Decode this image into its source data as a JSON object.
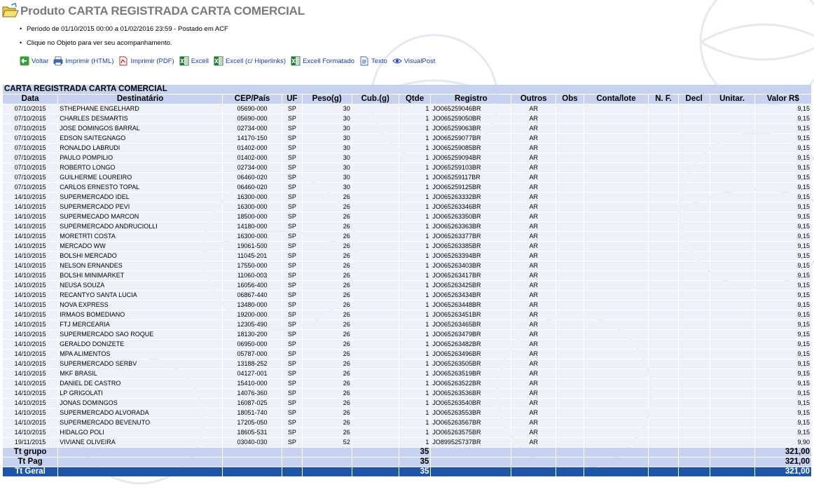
{
  "page": {
    "title": "Produto CARTA REGISTRADA CARTA COMERCIAL",
    "bullets": [
      "Período de 01/10/2015 00:00 a 01/02/2016 23:59 - Postado em ACF",
      "Clique no Objeto para ver seu acompanhamento."
    ]
  },
  "toolbar": [
    {
      "label": "Voltar",
      "icon": "back-arrow-icon"
    },
    {
      "label": "Imprimir (HTML)",
      "icon": "printer-icon"
    },
    {
      "label": "Imprimir (PDF)",
      "icon": "pdf-icon"
    },
    {
      "label": "Excell",
      "icon": "excel-icon"
    },
    {
      "label": "Excell (c/ Hiperlinks)",
      "icon": "excel-icon"
    },
    {
      "label": "Excell Formatado",
      "icon": "excel-icon"
    },
    {
      "label": "Texto",
      "icon": "text-file-icon"
    },
    {
      "label": "VisualPost",
      "icon": "eye-icon"
    }
  ],
  "table": {
    "caption": "CARTA REGISTRADA CARTA COMERCIAL",
    "columns": [
      "Data",
      "Destinatário",
      "CEP/País",
      "UF",
      "Peso(g)",
      "Cub.(g)",
      "Qtde",
      "Registro",
      "Outros",
      "Obs",
      "Conta/lote",
      "N. F.",
      "Decl",
      "Unitar.",
      "Valor R$"
    ],
    "rows": [
      [
        "07/10/2015",
        "STHEPHANE ENGELHARD",
        "05690-000",
        "SP",
        "30",
        "",
        "1",
        "JO065259046BR",
        "AR",
        "",
        "",
        "",
        "",
        "",
        "9,15"
      ],
      [
        "07/10/2015",
        "CHARLES DESMARTIS",
        "05690-000",
        "SP",
        "30",
        "",
        "1",
        "JO065259050BR",
        "AR",
        "",
        "",
        "",
        "",
        "",
        "9,15"
      ],
      [
        "07/10/2015",
        "JOSE DOMINGOS BARRAL",
        "02734-000",
        "SP",
        "30",
        "",
        "1",
        "JO065259063BR",
        "AR",
        "",
        "",
        "",
        "",
        "",
        "9,15"
      ],
      [
        "07/10/2015",
        "EDSON SAITEGNAGO",
        "14170-150",
        "SP",
        "30",
        "",
        "1",
        "JO065259077BR",
        "AR",
        "",
        "",
        "",
        "",
        "",
        "9,15"
      ],
      [
        "07/10/2015",
        "RONALDO LABRUDI",
        "01402-000",
        "SP",
        "30",
        "",
        "1",
        "JO065259085BR",
        "AR",
        "",
        "",
        "",
        "",
        "",
        "9,15"
      ],
      [
        "07/10/2015",
        "PAULO POMPILIO",
        "01402-000",
        "SP",
        "30",
        "",
        "1",
        "JO065259094BR",
        "AR",
        "",
        "",
        "",
        "",
        "",
        "9,15"
      ],
      [
        "07/10/2015",
        "ROBERTO LONGO",
        "02734-000",
        "SP",
        "30",
        "",
        "1",
        "JO065259103BR",
        "AR",
        "",
        "",
        "",
        "",
        "",
        "9,15"
      ],
      [
        "07/10/2015",
        "GUILHERME LOUREIRO",
        "06460-020",
        "SP",
        "30",
        "",
        "1",
        "JO065259117BR",
        "AR",
        "",
        "",
        "",
        "",
        "",
        "9,15"
      ],
      [
        "07/10/2015",
        "CARLOS ERNESTO TOPAL",
        "06460-020",
        "SP",
        "30",
        "",
        "1",
        "JO065259125BR",
        "AR",
        "",
        "",
        "",
        "",
        "",
        "9,15"
      ],
      [
        "14/10/2015",
        "SUPERMERCADO IDEL",
        "16300-000",
        "SP",
        "26",
        "",
        "1",
        "JO065263332BR",
        "AR",
        "",
        "",
        "",
        "",
        "",
        "9,15"
      ],
      [
        "14/10/2015",
        "SUPERMERCADO PEVI",
        "16300-000",
        "SP",
        "26",
        "",
        "1",
        "JO065263346BR",
        "AR",
        "",
        "",
        "",
        "",
        "",
        "9,15"
      ],
      [
        "14/10/2015",
        "SUPERMECADO MARCON",
        "18500-000",
        "SP",
        "26",
        "",
        "1",
        "JO065263350BR",
        "AR",
        "",
        "",
        "",
        "",
        "",
        "9,15"
      ],
      [
        "14/10/2015",
        "SUPERMERCADO ANDRUCIOLLI",
        "14180-000",
        "SP",
        "26",
        "",
        "1",
        "JO065263363BR",
        "AR",
        "",
        "",
        "",
        "",
        "",
        "9,15"
      ],
      [
        "14/10/2015",
        "MORETRTI COSTA",
        "16300-000",
        "SP",
        "26",
        "",
        "1",
        "JO065263377BR",
        "AR",
        "",
        "",
        "",
        "",
        "",
        "9,15"
      ],
      [
        "14/10/2015",
        "MERCADO WW",
        "19061-500",
        "SP",
        "26",
        "",
        "1",
        "JO065263385BR",
        "AR",
        "",
        "",
        "",
        "",
        "",
        "9,15"
      ],
      [
        "14/10/2015",
        "BOLSHI MERCADO",
        "11045-201",
        "SP",
        "26",
        "",
        "1",
        "JO065263394BR",
        "AR",
        "",
        "",
        "",
        "",
        "",
        "9,15"
      ],
      [
        "14/10/2015",
        "NELSON ERNANDES",
        "17550-000",
        "SP",
        "26",
        "",
        "1",
        "JO065263403BR",
        "AR",
        "",
        "",
        "",
        "",
        "",
        "9,15"
      ],
      [
        "14/10/2015",
        "BOLSHI MINIMARKET",
        "11060-003",
        "SP",
        "26",
        "",
        "1",
        "JO065263417BR",
        "AR",
        "",
        "",
        "",
        "",
        "",
        "9,15"
      ],
      [
        "14/10/2015",
        "NEUSA SOUZA",
        "16056-400",
        "SP",
        "26",
        "",
        "1",
        "JO065263425BR",
        "AR",
        "",
        "",
        "",
        "",
        "",
        "9,15"
      ],
      [
        "14/10/2015",
        "RECANTYO SANTA LUCIA",
        "06867-440",
        "SP",
        "26",
        "",
        "1",
        "JO065263434BR",
        "AR",
        "",
        "",
        "",
        "",
        "",
        "9,15"
      ],
      [
        "14/10/2015",
        "NOVA EXPRESS",
        "13480-000",
        "SP",
        "26",
        "",
        "1",
        "JO065263448BR",
        "AR",
        "",
        "",
        "",
        "",
        "",
        "9,15"
      ],
      [
        "14/10/2015",
        "IRMAOS BOMEDIANO",
        "19200-000",
        "SP",
        "26",
        "",
        "1",
        "JO065263451BR",
        "AR",
        "",
        "",
        "",
        "",
        "",
        "9,15"
      ],
      [
        "14/10/2015",
        "FTJ MERCEARIA",
        "12305-490",
        "SP",
        "26",
        "",
        "1",
        "JO065263465BR",
        "AR",
        "",
        "",
        "",
        "",
        "",
        "9,15"
      ],
      [
        "14/10/2015",
        "SUPERMERCADO SAO ROQUE",
        "18130-200",
        "SP",
        "26",
        "",
        "1",
        "JO065263479BR",
        "AR",
        "",
        "",
        "",
        "",
        "",
        "9,15"
      ],
      [
        "14/10/2015",
        "GERALDO DONIZETE",
        "06950-000",
        "SP",
        "26",
        "",
        "1",
        "JO065263482BR",
        "AR",
        "",
        "",
        "",
        "",
        "",
        "9,15"
      ],
      [
        "14/10/2015",
        "MPA ALIMENTOS",
        "05787-000",
        "SP",
        "26",
        "",
        "1",
        "JO065263496BR",
        "AR",
        "",
        "",
        "",
        "",
        "",
        "9,15"
      ],
      [
        "14/10/2015",
        "SUPERMERCADO SERBV",
        "13188-252",
        "SP",
        "26",
        "",
        "1",
        "JO065263505BR",
        "AR",
        "",
        "",
        "",
        "",
        "",
        "9,15"
      ],
      [
        "14/10/2015",
        "MKF BRASIL",
        "04127-001",
        "SP",
        "26",
        "",
        "1",
        "JO065263519BR",
        "AR",
        "",
        "",
        "",
        "",
        "",
        "9,15"
      ],
      [
        "14/10/2015",
        "DANIEL DE CASTRO",
        "15410-000",
        "SP",
        "26",
        "",
        "1",
        "JO065263522BR",
        "AR",
        "",
        "",
        "",
        "",
        "",
        "9,15"
      ],
      [
        "14/10/2015",
        "LP GRIGOLATI",
        "14076-360",
        "SP",
        "26",
        "",
        "1",
        "JO065263536BR",
        "AR",
        "",
        "",
        "",
        "",
        "",
        "9,15"
      ],
      [
        "14/10/2015",
        "JONAS DOMINGOS",
        "16087-025",
        "SP",
        "26",
        "",
        "1",
        "JO065263540BR",
        "AR",
        "",
        "",
        "",
        "",
        "",
        "9,15"
      ],
      [
        "14/10/2015",
        "SUPERMERCADO ALVORADA",
        "18051-740",
        "SP",
        "26",
        "",
        "1",
        "JO065263553BR",
        "AR",
        "",
        "",
        "",
        "",
        "",
        "9,15"
      ],
      [
        "14/10/2015",
        "SUPERMERCADO BEVENUTO",
        "17205-050",
        "SP",
        "26",
        "",
        "1",
        "JO065263567BR",
        "AR",
        "",
        "",
        "",
        "",
        "",
        "9,15"
      ],
      [
        "14/10/2015",
        "HIDALGO POLI",
        "18605-531",
        "SP",
        "26",
        "",
        "1",
        "JO065263575BR",
        "AR",
        "",
        "",
        "",
        "",
        "",
        "9,15"
      ],
      [
        "19/11/2015",
        "VIVIANE OLIVEIRA",
        "03040-030",
        "SP",
        "52",
        "",
        "1",
        "JO899525737BR",
        "AR",
        "",
        "",
        "",
        "",
        "",
        "9,90"
      ]
    ],
    "totals": [
      {
        "label": "Tt grupo",
        "qtde": "35",
        "valor": "321,00"
      },
      {
        "label": "Tt Pag",
        "qtde": "35",
        "valor": "321,00"
      }
    ],
    "grand_total": {
      "label": "Tt Geral",
      "qtde": "35",
      "valor": "321,00"
    }
  }
}
